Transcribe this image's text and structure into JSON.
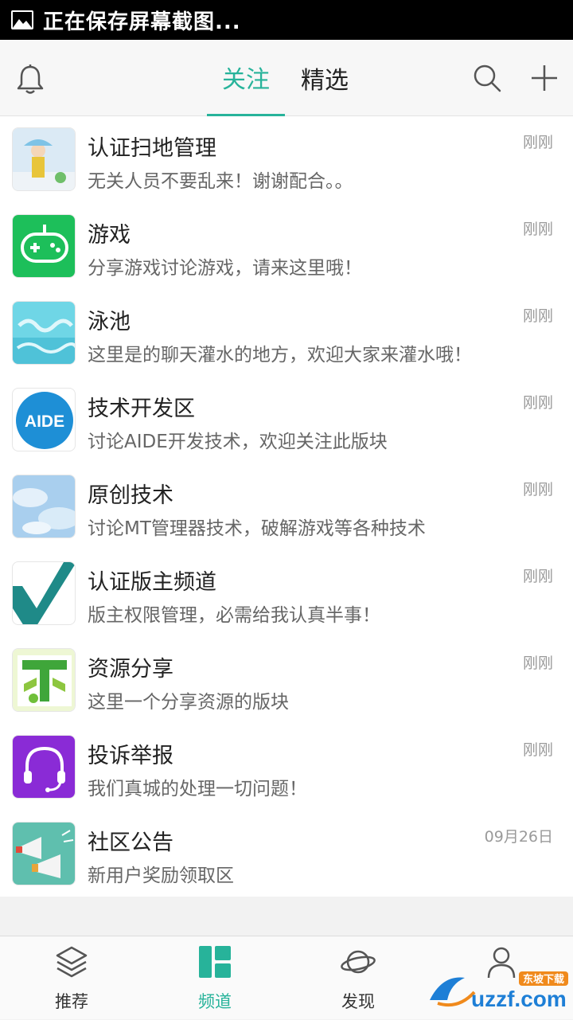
{
  "status_bar": {
    "text": "正在保存屏幕截图..."
  },
  "header": {
    "tabs": [
      {
        "label": "关注",
        "active": true
      },
      {
        "label": "精选",
        "active": false
      }
    ]
  },
  "channels": [
    {
      "title": "认证扫地管理",
      "desc": "无关人员不要乱来！谢谢配合。。",
      "time": "刚刚"
    },
    {
      "title": "游戏",
      "desc": "分享游戏讨论游戏，请来这里哦！",
      "time": "刚刚"
    },
    {
      "title": "泳池",
      "desc": "这里是的聊天灌水的地方，欢迎大家来灌水哦！",
      "time": "刚刚"
    },
    {
      "title": "技术开发区",
      "desc": "讨论AIDE开发技术，欢迎关注此版块",
      "time": "刚刚",
      "logo_text": "AIDE"
    },
    {
      "title": "原创技术",
      "desc": "讨论MT管理器技术，破解游戏等各种技术",
      "time": "刚刚"
    },
    {
      "title": "认证版主频道",
      "desc": "版主权限管理，必需给我认真半事！",
      "time": "刚刚"
    },
    {
      "title": "资源分享",
      "desc": "这里一个分享资源的版块",
      "time": "刚刚"
    },
    {
      "title": "投诉举报",
      "desc": "我们真城的处理一切问题！",
      "time": "刚刚"
    },
    {
      "title": "社区公告",
      "desc": "新用户奖励领取区",
      "time": "09月26日"
    }
  ],
  "bottom_nav": [
    {
      "label": "推荐",
      "icon": "layers-icon"
    },
    {
      "label": "频道",
      "icon": "grid-icon",
      "active": true
    },
    {
      "label": "发现",
      "icon": "planet-icon"
    },
    {
      "label": "",
      "icon": "person-icon"
    }
  ],
  "watermark": {
    "text": "uzzf.com",
    "sub": "东坡下载"
  },
  "colors": {
    "accent": "#27b39a",
    "status_bg": "#000000"
  }
}
